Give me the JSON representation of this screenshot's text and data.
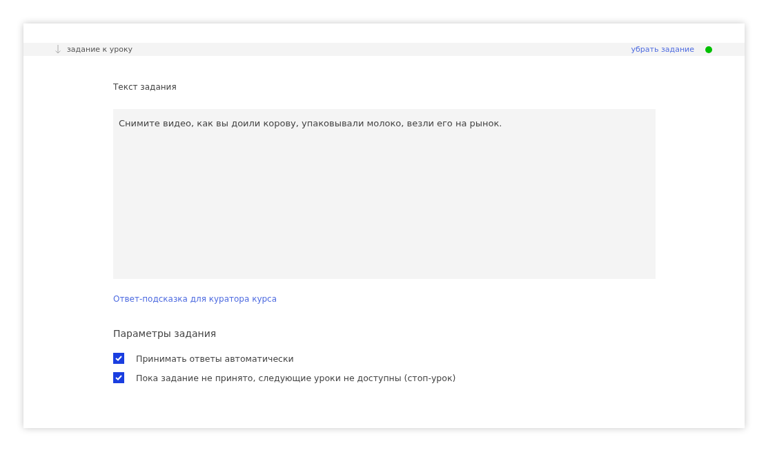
{
  "header": {
    "title": "задание к уроку",
    "remove_link": "убрать задание",
    "enabled": true
  },
  "task_text": {
    "label": "Текст задания",
    "value": "Снимите видео, как вы доили корову, упаковывали молоко, везли его на рынок."
  },
  "hint_link": "Ответ-подсказка для куратора курса",
  "parameters": {
    "title": "Параметры задания",
    "options": [
      {
        "label": "Принимать ответы автоматически",
        "checked": true
      },
      {
        "label": "Пока задание не принято, следующие уроки не доступны (стоп-урок)",
        "checked": true
      }
    ]
  }
}
